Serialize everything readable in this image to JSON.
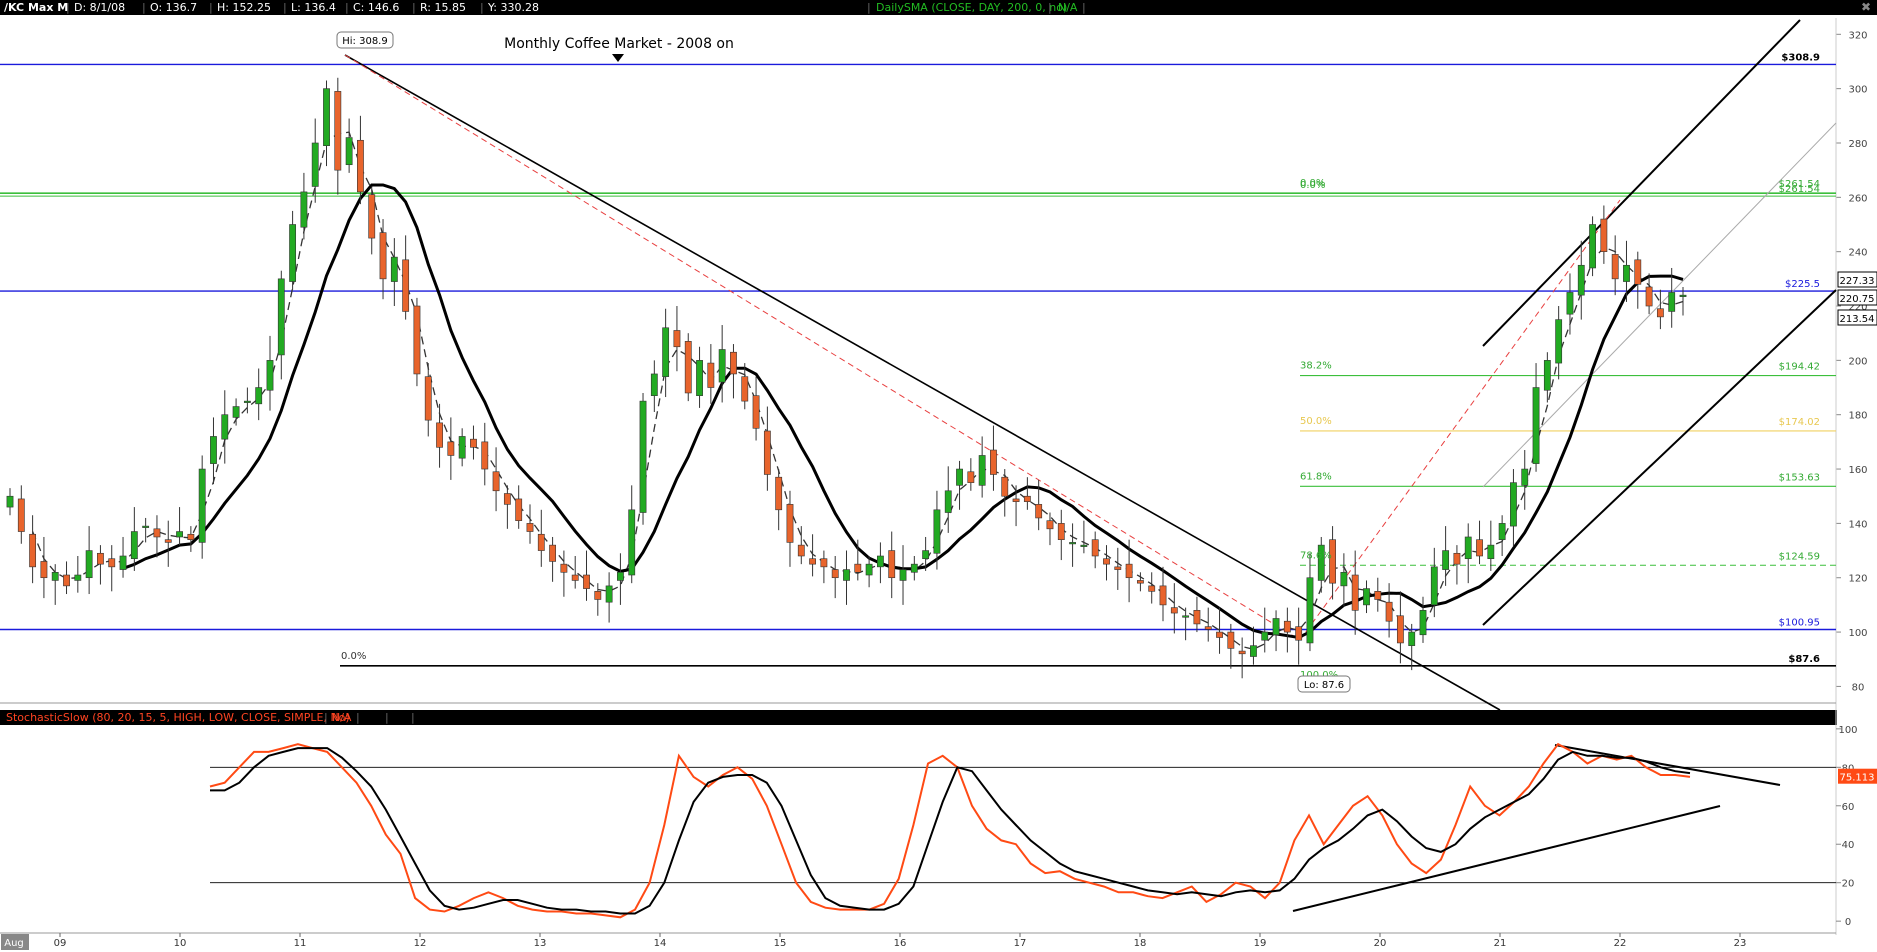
{
  "header": {
    "symbol": "/KC Max M",
    "date": "D: 8/1/08",
    "open": "O: 136.7",
    "high": "H: 152.25",
    "low": "L: 136.4",
    "close": "C: 146.6",
    "range": "R: 15.85",
    "cursor_y": "Y: 330.28",
    "study": "DailySMA (CLOSE, DAY, 200, 0, no)",
    "study_value": "N/A",
    "close_icon": "close-icon"
  },
  "indicator": {
    "label": "StochasticSlow (80, 20, 15, 5, HIGH, LOW, CLOSE, SIMPLE, No)",
    "value": "N/A",
    "last_value": "75.113"
  },
  "annotations": {
    "title": "Monthly Coffee Market - 2008 on",
    "hi_bubble": "Hi: 308.9",
    "lo_bubble": "Lo: 87.6",
    "fib_left_zero": "0.0%",
    "fib_left_hundred": "100.0%",
    "fib_right_top": "0.0%",
    "fib_right_bottom": "100.0%"
  },
  "colors": {
    "up_candle": "#22aa22",
    "down_candle": "#e8642c",
    "horizontal_line": "#1a1adc",
    "fib_line": "#3cbf3c",
    "fib_50": "#f0d060",
    "stoch_k": "#ff4a14",
    "stoch_d": "#000000"
  },
  "chart_data": [
    {
      "type": "candlestick",
      "title": "Monthly Coffee Market - 2008 on",
      "x_labels": [
        "Aug",
        "09",
        "10",
        "11",
        "12",
        "13",
        "14",
        "15",
        "16",
        "17",
        "18",
        "19",
        "20",
        "21",
        "22",
        "23"
      ],
      "y_ticks": [
        80,
        100,
        120,
        140,
        160,
        180,
        200,
        220,
        240,
        260,
        280,
        300,
        320
      ],
      "ylim": [
        75,
        326
      ],
      "price_labels": [
        "$308.9",
        "$225.5",
        "$100.95",
        "$87.6"
      ],
      "right_badges": [
        "227.33",
        "220.75",
        "213.54"
      ],
      "horizontal_levels": [
        {
          "label": "$308.9",
          "value": 308.9
        },
        {
          "label": "$225.5",
          "value": 225.5
        },
        {
          "label": "$100.95",
          "value": 100.95
        },
        {
          "label": "$87.6",
          "value": 87.6
        }
      ],
      "fib_levels": [
        {
          "pct": "0.0%",
          "price": "$261.54",
          "value": 261.54
        },
        {
          "pct": "38.2%",
          "price": "$194.42",
          "value": 194.42
        },
        {
          "pct": "50.0%",
          "price": "$174.02",
          "value": 174.02
        },
        {
          "pct": "61.8%",
          "price": "$153.63",
          "value": 153.63
        },
        {
          "pct": "78.6%",
          "price": "$124.59",
          "value": 124.59
        }
      ],
      "fib_dup_price": "$261.54",
      "hi": 308.9,
      "lo": 87.6,
      "close_series": [
        150,
        137,
        124,
        120,
        122,
        117,
        121,
        130,
        125,
        124,
        128,
        137,
        139,
        135,
        133,
        137,
        134,
        160,
        172,
        180,
        183,
        185,
        190,
        200,
        230,
        250,
        262,
        280,
        300,
        270,
        282,
        262,
        245,
        230,
        238,
        218,
        195,
        178,
        168,
        165,
        172,
        168,
        160,
        152,
        147,
        141,
        137,
        130,
        126,
        122,
        119,
        116,
        112,
        117,
        122,
        145,
        185,
        195,
        212,
        205,
        188,
        200,
        190,
        204,
        195,
        185,
        175,
        158,
        145,
        133,
        128,
        125,
        124,
        120,
        123,
        122,
        125,
        128,
        120,
        123,
        125,
        130,
        145,
        152,
        160,
        155,
        165,
        158,
        150,
        148,
        148,
        142,
        138,
        134,
        133,
        132,
        128,
        125,
        123,
        120,
        118,
        115,
        110,
        107,
        106,
        103,
        101,
        98,
        94,
        92,
        95,
        100,
        105,
        100,
        97,
        120,
        132,
        118,
        122,
        108,
        116,
        112,
        104,
        96,
        100,
        108,
        124,
        130,
        125,
        135,
        128,
        132,
        140,
        155,
        160,
        190,
        200,
        215,
        225,
        235,
        250,
        240,
        230,
        235,
        228,
        220,
        216,
        225,
        224
      ]
    },
    {
      "type": "line",
      "title": "StochasticSlow (80, 20, 15, 5, HIGH, LOW, CLOSE, SIMPLE, No)",
      "y_ticks": [
        0,
        20,
        40,
        60,
        80,
        100
      ],
      "ylim": [
        -2,
        102
      ],
      "reference_lines": [
        80,
        20
      ],
      "series": [
        {
          "name": "%K",
          "values": [
            70,
            72,
            80,
            88,
            88,
            90,
            92,
            90,
            88,
            80,
            72,
            60,
            45,
            35,
            12,
            6,
            5,
            8,
            12,
            15,
            12,
            8,
            6,
            5,
            5,
            4,
            4,
            3,
            2,
            6,
            20,
            50,
            86,
            75,
            70,
            76,
            80,
            74,
            60,
            40,
            20,
            10,
            7,
            6,
            6,
            6,
            9,
            22,
            50,
            82,
            86,
            80,
            60,
            48,
            42,
            40,
            30,
            25,
            26,
            22,
            20,
            18,
            15,
            15,
            13,
            12,
            15,
            18,
            10,
            14,
            20,
            18,
            12,
            20,
            42,
            55,
            40,
            50,
            60,
            65,
            55,
            40,
            30,
            25,
            32,
            50,
            70,
            60,
            55,
            62,
            70,
            82,
            92,
            88,
            82,
            86,
            84,
            86,
            80,
            76,
            76,
            75
          ]
        },
        {
          "name": "%D",
          "values": [
            68,
            68,
            72,
            80,
            86,
            88,
            90,
            90,
            90,
            85,
            78,
            70,
            58,
            44,
            30,
            16,
            8,
            6,
            7,
            9,
            11,
            11,
            9,
            7,
            6,
            6,
            5,
            5,
            4,
            4,
            8,
            20,
            42,
            62,
            72,
            75,
            76,
            76,
            72,
            60,
            42,
            24,
            12,
            8,
            7,
            6,
            6,
            9,
            18,
            40,
            62,
            80,
            78,
            68,
            58,
            50,
            42,
            36,
            30,
            26,
            24,
            22,
            20,
            18,
            16,
            15,
            14,
            15,
            14,
            13,
            15,
            16,
            15,
            16,
            22,
            32,
            38,
            42,
            48,
            55,
            58,
            52,
            44,
            38,
            36,
            40,
            48,
            54,
            58,
            62,
            66,
            74,
            84,
            88,
            86,
            86,
            85,
            85,
            83,
            80,
            78,
            77
          ]
        }
      ]
    }
  ]
}
